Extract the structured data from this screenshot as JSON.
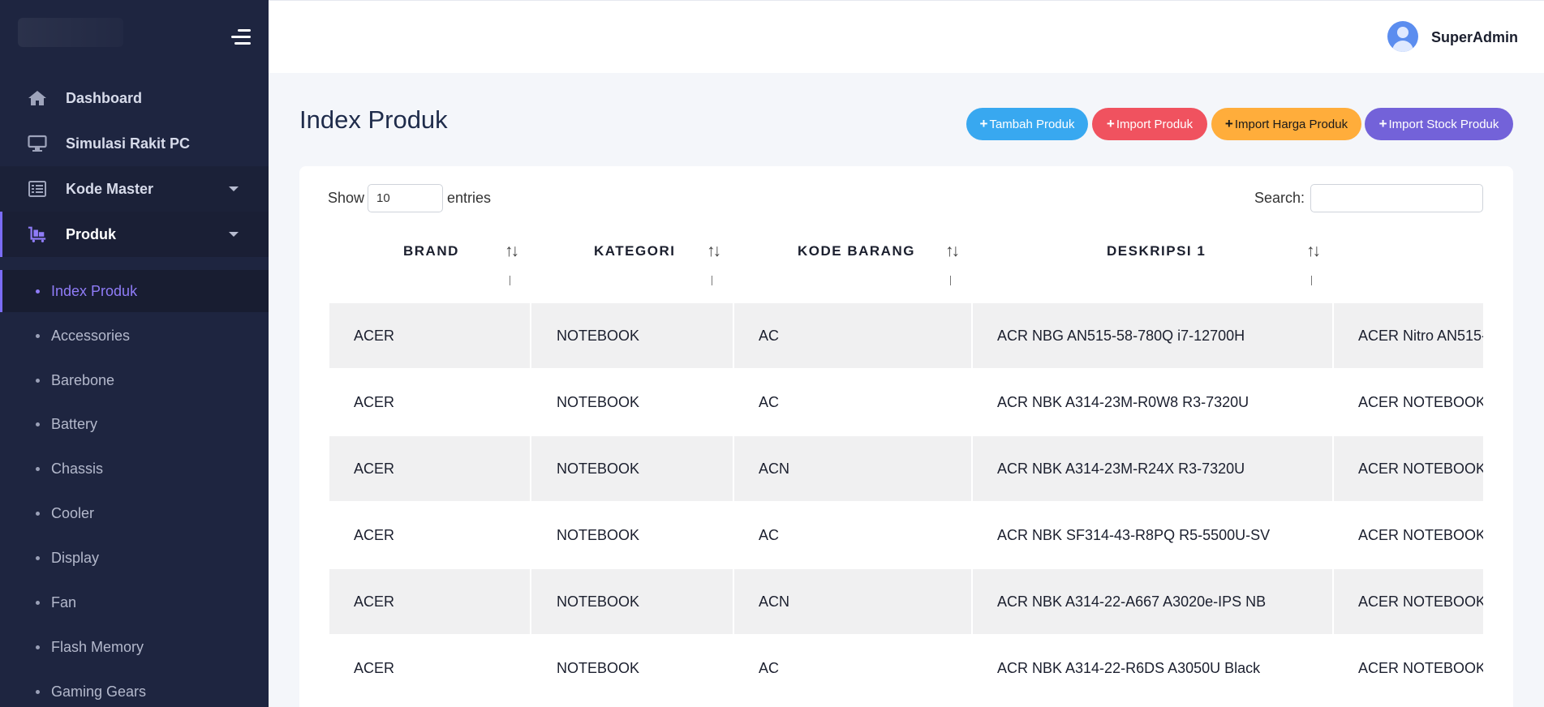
{
  "header": {
    "user_name": "SuperAdmin"
  },
  "sidebar": {
    "items": [
      {
        "label": "Dashboard",
        "icon": "home-icon"
      },
      {
        "label": "Simulasi Rakit PC",
        "icon": "monitor-icon"
      },
      {
        "label": "Kode Master",
        "icon": "list-icon"
      },
      {
        "label": "Produk",
        "icon": "cart-icon"
      }
    ],
    "sub_items": [
      "Index Produk",
      "Accessories",
      "Barebone",
      "Battery",
      "Chassis",
      "Cooler",
      "Display",
      "Fan",
      "Flash Memory",
      "Gaming Gears"
    ],
    "active_color": "#8f7cf7",
    "background_color": "#1e2540"
  },
  "page": {
    "title": "Index Produk",
    "buttons": {
      "tambah": "Tambah Produk",
      "import": "Import Produk",
      "harga": "Import Harga Produk",
      "stock": "Import Stock Produk"
    },
    "button_colors": {
      "tambah": "#38a8f0",
      "import": "#f0525f",
      "harga": "#ffad3b",
      "stock": "#7362d9"
    }
  },
  "table": {
    "show_label": "Show",
    "page_length": "10",
    "entries_label": "entries",
    "search_label": "Search:",
    "columns": [
      "BRAND",
      "KATEGORI",
      "KODE BARANG",
      "DESKRIPSI 1"
    ],
    "rows": [
      [
        "ACER",
        "NOTEBOOK",
        "AC",
        "ACR NBG AN515-58-780Q i7-12700H",
        "ACER Nitro AN515-"
      ],
      [
        "ACER",
        "NOTEBOOK",
        "AC",
        "ACR NBK A314-23M-R0W8 R3-7320U",
        "ACER NOTEBOOK A"
      ],
      [
        "ACER",
        "NOTEBOOK",
        "ACN",
        "ACR NBK A314-23M-R24X R3-7320U",
        "ACER NOTEBOOK A"
      ],
      [
        "ACER",
        "NOTEBOOK",
        "AC",
        "ACR NBK SF314-43-R8PQ R5-5500U-SV",
        "ACER NOTEBOOK S"
      ],
      [
        "ACER",
        "NOTEBOOK",
        "ACN",
        "ACR NBK A314-22-A667 A3020e-IPS NB",
        "ACER NOTEBOOK A"
      ],
      [
        "ACER",
        "NOTEBOOK",
        "AC",
        "ACR NBK A314-22-R6DS A3050U Black",
        "ACER NOTEBOOK A"
      ]
    ]
  }
}
